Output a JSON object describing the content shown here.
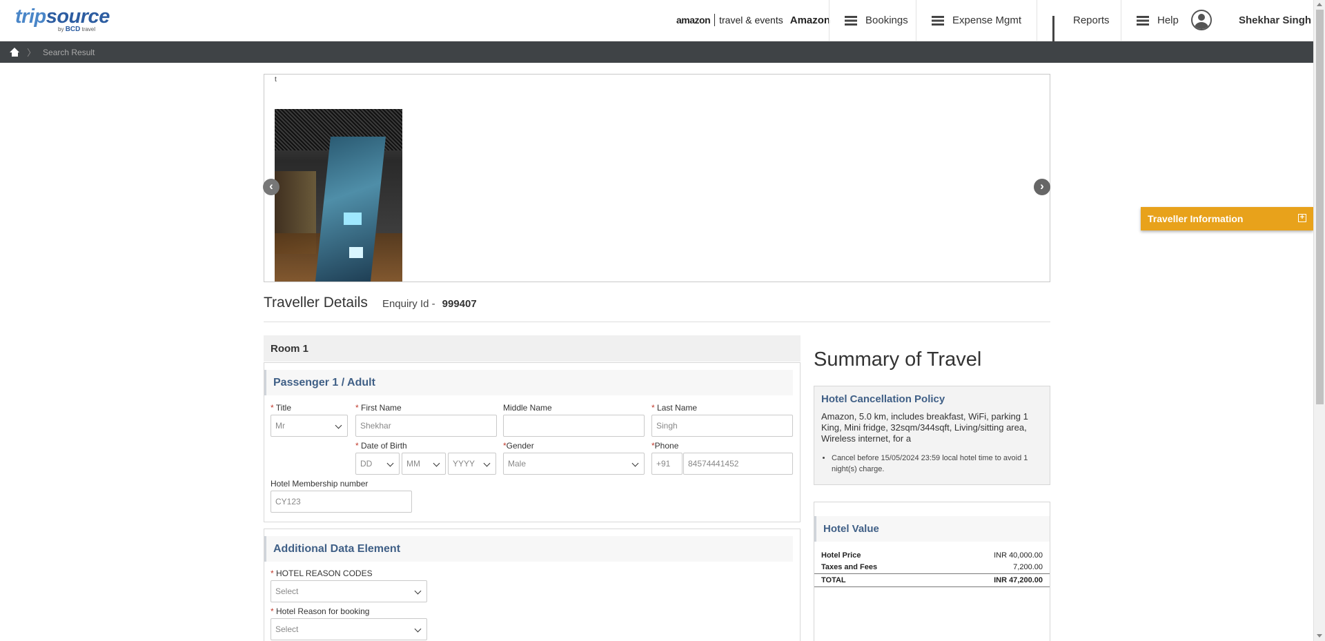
{
  "header": {
    "logo": {
      "brand_a": "trip",
      "brand_b": "source",
      "sub_by": "by",
      "sub_bcd": "BCD",
      "sub_travel": "travel"
    },
    "partner": {
      "logo": "amazon",
      "tagline": "travel & events",
      "company": "Amazon"
    },
    "nav": [
      {
        "label": "Bookings",
        "icon": "menu-icon"
      },
      {
        "label": "Expense Mgmt",
        "icon": "menu-icon"
      },
      {
        "label": "Reports",
        "icon": "bar-chart-icon"
      },
      {
        "label": "Help",
        "icon": "menu-icon"
      }
    ],
    "user": {
      "name": "Shekhar Singh",
      "icon": "user-avatar-icon"
    }
  },
  "breadcrumb": {
    "home_icon": "home-icon",
    "current": "Search Result"
  },
  "gallery": {
    "caption": "t",
    "prev": "‹",
    "next": "›"
  },
  "traveller_info_tab": {
    "label": "Traveller Information",
    "icon": "expand-plus-icon"
  },
  "traveller_details": {
    "title": "Traveller Details",
    "enquiry_label": "Enquiry Id -",
    "enquiry_id": "999407"
  },
  "room": {
    "title": "Room 1",
    "passenger": {
      "heading": "Passenger 1 / Adult",
      "title_label": "Title",
      "title_value": "Mr",
      "first_name_label": "First Name",
      "first_name_value": "Shekhar",
      "middle_name_label": "Middle Name",
      "middle_name_value": "",
      "last_name_label": "Last Name",
      "last_name_value": "Singh",
      "dob_label": "Date of Birth",
      "dob_day": "DD",
      "dob_month": "MM",
      "dob_year": "YYYY",
      "gender_label": "Gender",
      "gender_value": "Male",
      "phone_label": "Phone",
      "phone_code": "+91",
      "phone_value": "84574441452",
      "membership_label": "Hotel Membership number",
      "membership_value": "CY123"
    },
    "additional": {
      "heading": "Additional Data Element",
      "reason_codes_label": "HOTEL REASON CODES",
      "reason_codes_value": "Select",
      "reason_booking_label": "Hotel Reason for booking",
      "reason_booking_value": "Select"
    }
  },
  "summary": {
    "title": "Summary of Travel",
    "policy": {
      "heading": "Hotel Cancellation Policy",
      "description": "Amazon, 5.0 km, includes breakfast, WiFi, parking 1 King, Mini fridge, 32sqm/344sqft, Living/sitting area, Wireless internet, for a",
      "rules": [
        "Cancel before 15/05/2024 23:59 local hotel time to avoid 1 night(s) charge."
      ]
    },
    "value": {
      "heading": "Hotel Value",
      "rows": [
        {
          "label": "Hotel Price",
          "value": "INR 40,000.00"
        },
        {
          "label": "Taxes and Fees",
          "value": "7,200.00"
        }
      ],
      "total_label": "TOTAL",
      "total_value": "INR 47,200.00"
    }
  }
}
